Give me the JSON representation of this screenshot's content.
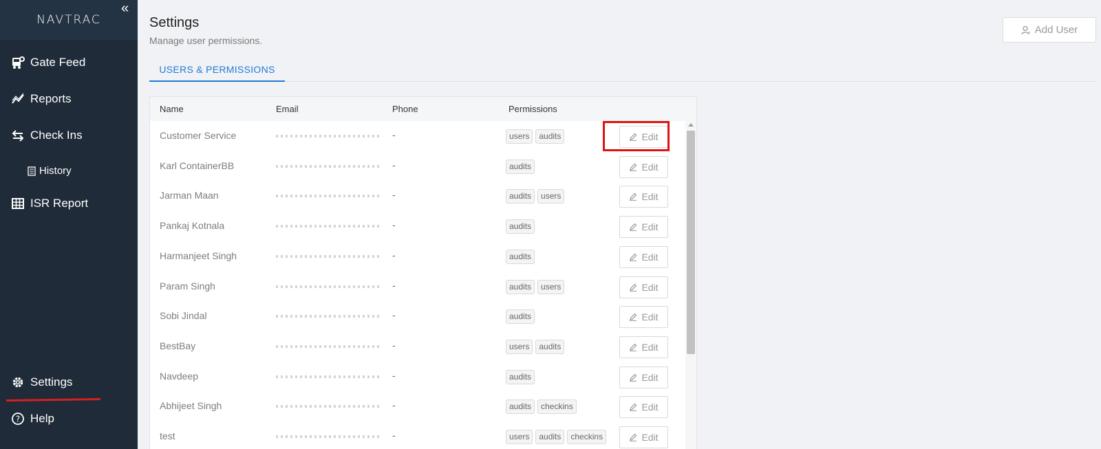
{
  "sidebar": {
    "brand": "NAVTRAC",
    "collapse_glyph": "«",
    "items": [
      {
        "label": "Gate Feed",
        "icon": "bus-icon"
      },
      {
        "label": "Reports",
        "icon": "chart-line-icon"
      },
      {
        "label": "Check Ins",
        "icon": "swap-icon"
      },
      {
        "label": "History",
        "icon": "document-icon"
      },
      {
        "label": "ISR Report",
        "icon": "table-icon"
      },
      {
        "label": "Settings",
        "icon": "gear-icon"
      },
      {
        "label": "Help",
        "icon": "question-circle-icon"
      }
    ]
  },
  "header": {
    "title": "Settings",
    "subtitle": "Manage user permissions.",
    "add_user_label": "Add User"
  },
  "tabs": [
    {
      "label": "USERS & PERMISSIONS",
      "active": true
    }
  ],
  "table": {
    "columns": [
      "Name",
      "Email",
      "Phone",
      "Permissions"
    ],
    "edit_label": "Edit",
    "rows": [
      {
        "name": "Customer Service",
        "phone": "-",
        "permissions": [
          "users",
          "audits"
        ]
      },
      {
        "name": "Karl ContainerBB",
        "phone": "-",
        "permissions": [
          "audits"
        ]
      },
      {
        "name": "Jarman Maan",
        "phone": "-",
        "permissions": [
          "audits",
          "users"
        ]
      },
      {
        "name": "Pankaj Kotnala",
        "phone": "-",
        "permissions": [
          "audits"
        ]
      },
      {
        "name": "Harmanjeet Singh",
        "phone": "-",
        "permissions": [
          "audits"
        ]
      },
      {
        "name": "Param Singh",
        "phone": "-",
        "permissions": [
          "audits",
          "users"
        ]
      },
      {
        "name": "Sobi Jindal",
        "phone": "-",
        "permissions": [
          "audits"
        ]
      },
      {
        "name": "BestBay",
        "phone": "-",
        "permissions": [
          "users",
          "audits"
        ]
      },
      {
        "name": "Navdeep",
        "phone": "-",
        "permissions": [
          "audits"
        ]
      },
      {
        "name": "Abhijeet Singh",
        "phone": "-",
        "permissions": [
          "audits",
          "checkins"
        ]
      },
      {
        "name": "test",
        "phone": "-",
        "permissions": [
          "users",
          "audits",
          "checkins"
        ]
      }
    ]
  },
  "colors": {
    "sidebar_bg": "#1f2b38",
    "accent": "#1f7ad8",
    "highlight": "#e01010"
  }
}
